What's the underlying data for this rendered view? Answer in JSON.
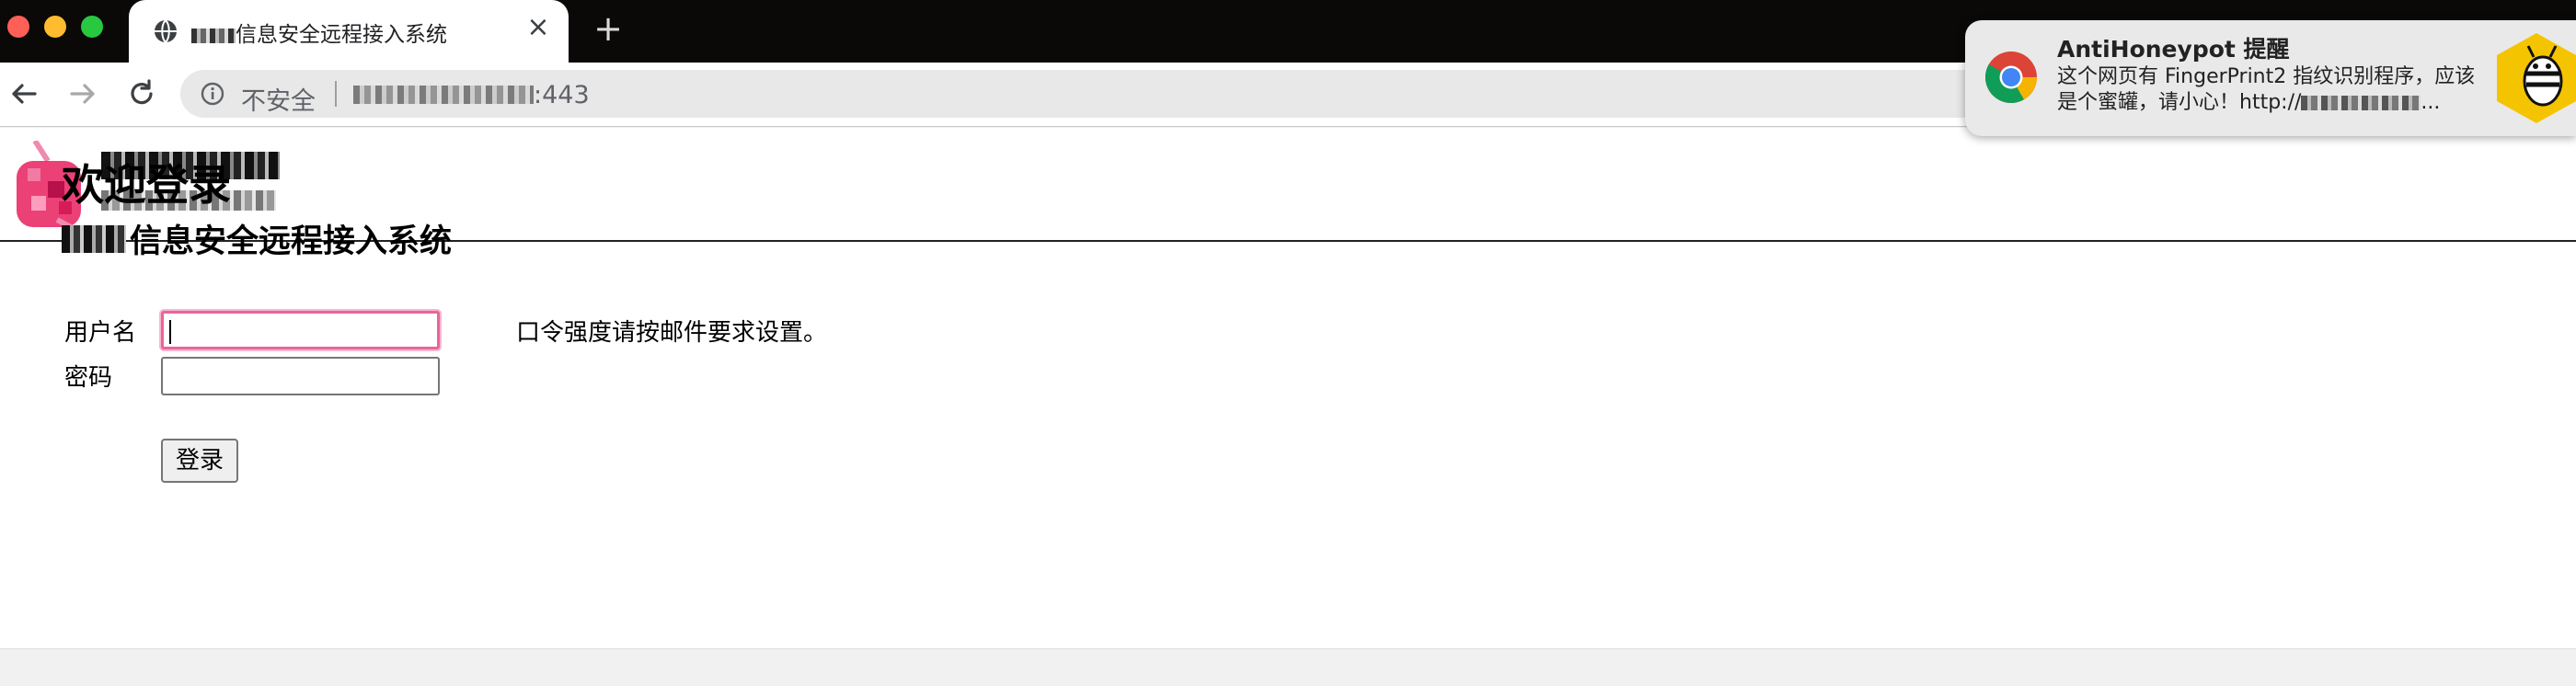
{
  "browser": {
    "tab_title": "信息安全远程接入系统",
    "tab_title_prefix_redacted": true,
    "close_glyph": "×",
    "new_tab_glyph": "+",
    "security_label": "不安全",
    "url_port": ":443"
  },
  "page": {
    "welcome": "欢迎登录",
    "system_title": "信息安全远程接入系统",
    "username_label": "用户名",
    "password_label": "密码",
    "username_value": "",
    "password_value": "",
    "password_hint": "口令强度请按邮件要求设置。",
    "login_button": "登录"
  },
  "notification": {
    "title": "AntiHoneypot 提醒",
    "body_line1": "这个网页有 FingerPrint2 指纹识别程序，应该",
    "body_line2_prefix": "是个蜜罐，请小心！http://",
    "body_line2_suffix": "...",
    "app_icon": "chrome-icon",
    "badge_icon": "bee-icon"
  },
  "colors": {
    "tab_strip": "#0b0808",
    "focus_ring": "#e8659a",
    "logo_accent": "#e8205f",
    "badge_yellow": "#f5c400"
  }
}
